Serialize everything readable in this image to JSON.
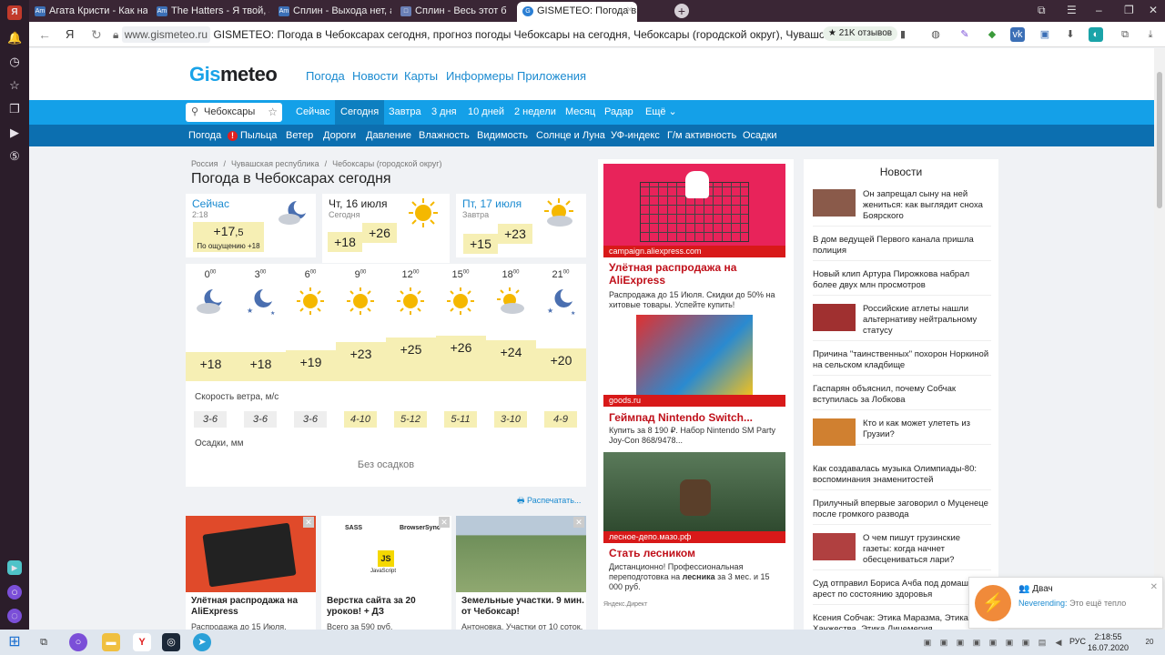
{
  "browser": {
    "tabs": [
      {
        "label": "Агата Кристи - Как на вой",
        "fav": "Am"
      },
      {
        "label": "The Hatters - Я твой, акко",
        "fav": "Am"
      },
      {
        "label": "Сплин - Выхода нет, акко",
        "fav": "Am"
      },
      {
        "label": "Сплин - Весь этот б",
        "fav": "□"
      },
      {
        "label": "GISMETEO: Погода в Че",
        "fav": "G"
      }
    ],
    "url_domain": "www.gismeteo.ru",
    "url_title": "GISMETEO: Погода в Чебоксарах сегодня, прогноз погоды Чебоксары на сегодня, Чебоксары (городской округ), Чувашская рес...",
    "reviews": "★ 21K отзывов"
  },
  "site": {
    "logo_g": "Gis",
    "logo_rest": "meteo",
    "topnav": [
      "Погода",
      "Новости",
      "Карты",
      "Информеры",
      "Приложения"
    ],
    "search_value": "Чебоксары",
    "menu1": [
      "Сейчас",
      "Сегодня",
      "Завтра",
      "3 дня",
      "10 дней",
      "2 недели",
      "Месяц",
      "Радар",
      "Ещё ⌄"
    ],
    "menu2": [
      "Погода",
      "Пыльца",
      "Ветер",
      "Дороги",
      "Давление",
      "Влажность",
      "Видимость",
      "Солнце и Луна",
      "УФ-индекс",
      "Г/м активность",
      "Осадки"
    ]
  },
  "forecast": {
    "breadcrumbs": [
      "Россия",
      "/",
      "Чувашская республика",
      "/",
      "Чебоксары (городской округ)"
    ],
    "title": "Погода в Чебоксарах сегодня",
    "now": {
      "label": "Сейчас",
      "time": "2:18",
      "temp_int": "+17",
      "temp_dec": ",5",
      "feels": "По ощущению +18"
    },
    "today": {
      "label": "Чт, 16 июля",
      "sub": "Сегодня",
      "min": "+18",
      "max": "+26"
    },
    "tomorrow": {
      "label": "Пт, 17 июля",
      "sub": "Завтра",
      "min": "+15",
      "max": "+23"
    },
    "hours": [
      {
        "h": "0",
        "t": "+18",
        "w": "3-6",
        "icon": "moon-cloud",
        "hi": false
      },
      {
        "h": "3",
        "t": "+18",
        "w": "3-6",
        "icon": "moon-stars",
        "hi": false
      },
      {
        "h": "6",
        "t": "+19",
        "w": "3-6",
        "icon": "sun",
        "hi": false
      },
      {
        "h": "9",
        "t": "+23",
        "w": "4-10",
        "icon": "sun",
        "hi": true
      },
      {
        "h": "12",
        "t": "+25",
        "w": "5-12",
        "icon": "sun",
        "hi": true
      },
      {
        "h": "15",
        "t": "+26",
        "w": "5-11",
        "icon": "sun",
        "hi": true
      },
      {
        "h": "18",
        "t": "+24",
        "w": "3-10",
        "icon": "sun-cloud",
        "hi": true
      },
      {
        "h": "21",
        "t": "+20",
        "w": "4-9",
        "icon": "moon-stars",
        "hi": true
      }
    ],
    "minute_sup": "00",
    "wind_label": "Скорость ветра, м/с",
    "precip_label": "Осадки, мм",
    "no_precip": "Без осадков",
    "print_label": "Распечатать..."
  },
  "ads_bottom": [
    {
      "title": "Улётная распродажа на AliExpress",
      "desc": "Распродажа до 15 Июля.",
      "color": "#e04a2a"
    },
    {
      "title": "Верстка сайта за 20 уроков! + ДЗ",
      "desc": "Всего за 590 руб.",
      "color": "#ffffff",
      "img_sass": "SASS",
      "img_bsync": "BrowserSync",
      "img_js": "JS",
      "img_js_lbl": "JavaScript"
    },
    {
      "title": "Земельные участки. 9 мин. от Чебоксар!",
      "desc": "Антоновка. Участки от 10 соток.",
      "color": "#6f8f5a"
    }
  ],
  "ads_mid": [
    {
      "caption": "campaign.aliexpress.com",
      "title": "Улётная распродажа на AliExpress",
      "desc": "Распродажа до 15 Июля. Скидки до 50% на хитовые товары. Успейте купить!"
    },
    {
      "caption": "goods.ru",
      "title": "Геймпад Nintendo Switch...",
      "desc": "Купить за 8 190 ₽. Набор Nintendo SM Party Joy-Con 868/9478..."
    },
    {
      "caption": "лесное-депо.мазо.рф",
      "title": "Стать лесником",
      "desc_pre": "Дистанционно! Профессиональная переподготовка на ",
      "desc_bold": "лесника",
      "desc_post": " за 3 мес. и 15 000 руб."
    }
  ],
  "ads_mid_footer": "Яндекс.Директ",
  "news": {
    "title": "Новости",
    "items": [
      {
        "text": "Он запрещал сыну на ней жениться: как выглядит сноха Боярского",
        "thumb": true,
        "color": "#8a5a4a"
      },
      {
        "text": "В дом ведущей Первого канала пришла полиция",
        "thumb": false
      },
      {
        "text": "Новый клип Артура Пирожкова набрал более двух млн просмотров",
        "thumb": false
      },
      {
        "text": "Российские атлеты нашли альтернативу нейтральному статусу",
        "thumb": true,
        "color": "#a03030"
      },
      {
        "text": "Причина \"таинственных\" похорон Норкиной на сельском кладбище",
        "thumb": false
      },
      {
        "text": "Гаспарян объяснил, почему Собчак вступилась за Лобкова",
        "thumb": false
      },
      {
        "text": "Кто и как может улететь из Грузии?",
        "thumb": true,
        "color": "#d08030"
      },
      {
        "text": "Как создавалась музыка Олимпиады-80: воспоминания знаменитостей",
        "thumb": false
      },
      {
        "text": "Прилучный впервые заговорил о Муценеце после громкого развода",
        "thumb": false
      },
      {
        "text": "О чем пишут грузинские газеты: когда начнет обесцениваться лари?",
        "thumb": true,
        "color": "#b04040"
      },
      {
        "text": "Суд отправил Бориса Ачба под домашний арест по состоянию здоровья",
        "thumb": false
      },
      {
        "text": "Ксения Собчак: Этика Маразма, Этика Ханжества, Этика Лицемерия",
        "thumb": false
      }
    ]
  },
  "notification": {
    "title": "Двач",
    "app": "Neverending:",
    "text": "Это ещё тепло"
  },
  "taskbar": {
    "lang": "РУС",
    "time": "2:18:55",
    "date": "16.07.2020",
    "badge": "20"
  }
}
